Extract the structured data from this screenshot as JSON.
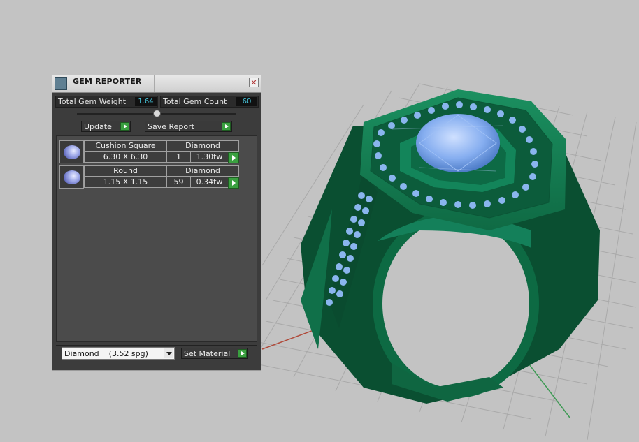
{
  "panel": {
    "title": "GEM REPORTER",
    "close_glyph": "✕",
    "total_weight_label": "Total Gem Weight",
    "total_weight_value": "1.64",
    "total_count_label": "Total Gem Count",
    "total_count_value": "60",
    "update_label": "Update",
    "save_report_label": "Save Report",
    "set_material_label": "Set Material",
    "material_select_value": "Diamond    (3.52 spg)"
  },
  "gems": [
    {
      "shape": "Cushion Square",
      "material": "Diamond",
      "size": "6.30 X 6.30",
      "count": "1",
      "weight": "1.30tw"
    },
    {
      "shape": "Round",
      "material": "Diamond",
      "size": "1.15 X 1.15",
      "count": "59",
      "weight": "0.34tw"
    }
  ],
  "colors": {
    "viewport_bg": "#c3c3c3",
    "ring_green": "#12744a",
    "gem_blue": "#7fa9e6",
    "axis_red": "#b04a3a",
    "axis_green": "#3f9a55"
  }
}
